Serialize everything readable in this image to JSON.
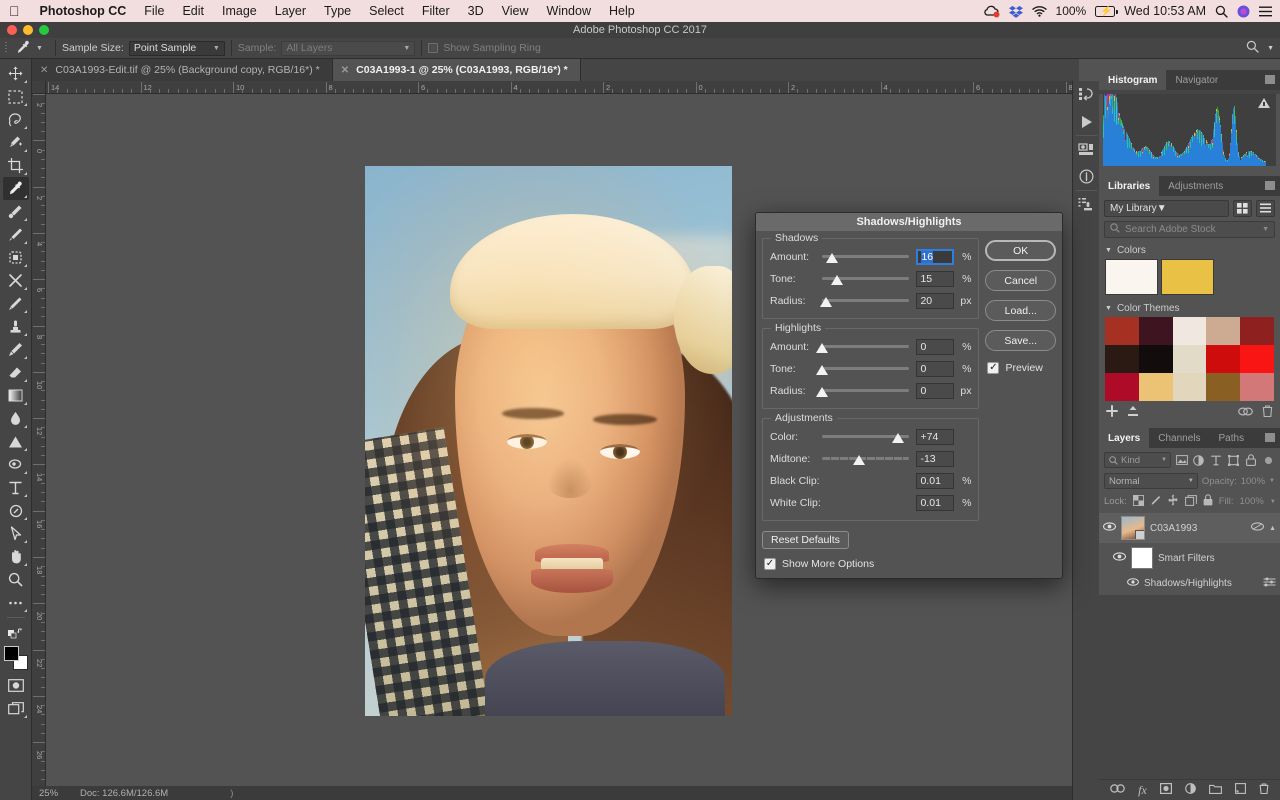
{
  "macbar": {
    "apple_icon": "apple-icon",
    "app_name": "Photoshop CC",
    "menus": [
      "File",
      "Edit",
      "Image",
      "Layer",
      "Type",
      "Select",
      "Filter",
      "3D",
      "View",
      "Window",
      "Help"
    ],
    "battery_pct": "100%",
    "clock": "Wed 10:53 AM",
    "right_icons": [
      "cloud-sync-icon",
      "dropbox-icon",
      "wifi-icon",
      "battery-icon",
      "spotlight-search-icon",
      "siri-icon",
      "notification-center-icon"
    ]
  },
  "titlebar": {
    "title": "Adobe Photoshop CC 2017",
    "traffic": [
      {
        "name": "close-button",
        "color": "#ff5f57"
      },
      {
        "name": "minimize-button",
        "color": "#febc2e"
      },
      {
        "name": "zoom-button",
        "color": "#28c840"
      }
    ]
  },
  "options_bar": {
    "tool_icon": "eyedropper-icon",
    "sample_size_label": "Sample Size:",
    "sample_size_value": "Point Sample",
    "sample_label": "Sample:",
    "sample_value": "All Layers",
    "show_sampling_ring_label": "Show Sampling Ring",
    "search_icon": "search-icon"
  },
  "tabs": [
    {
      "label": "C03A1993-Edit.tif @ 25% (Background copy, RGB/16*) *",
      "active": false
    },
    {
      "label": "C03A1993-1 @ 25% (C03A1993, RGB/16*) *",
      "active": true
    }
  ],
  "toolbar": {
    "tools": [
      {
        "name": "move-tool",
        "glyph": "move"
      },
      {
        "name": "rectangular-marquee-tool",
        "glyph": "marquee"
      },
      {
        "name": "lasso-tool",
        "glyph": "lasso"
      },
      {
        "name": "quick-selection-tool",
        "glyph": "wand"
      },
      {
        "name": "crop-tool",
        "glyph": "crop"
      },
      {
        "name": "eyedropper-tool",
        "glyph": "eyedropper",
        "active": true
      },
      {
        "name": "spot-healing-brush-tool",
        "glyph": "heal"
      },
      {
        "name": "brush-tool",
        "glyph": "brush2"
      },
      {
        "name": "clone-stamp-tool",
        "glyph": "patch"
      },
      {
        "name": "history-brush-tool",
        "glyph": "hbrush"
      },
      {
        "name": "eraser-tool",
        "glyph": "brush"
      },
      {
        "name": "stamp-tool",
        "glyph": "stamp"
      },
      {
        "name": "mixer-brush-tool",
        "glyph": "mixer"
      },
      {
        "name": "eraser-tool-2",
        "glyph": "eraser"
      },
      {
        "name": "gradient-tool",
        "glyph": "gradient"
      },
      {
        "name": "blur-tool",
        "glyph": "blur"
      },
      {
        "name": "dodge-tool",
        "glyph": "dodge"
      },
      {
        "name": "pen-tool",
        "glyph": "pen"
      },
      {
        "name": "type-tool",
        "glyph": "type"
      },
      {
        "name": "path-selection-tool",
        "glyph": "ellipse"
      },
      {
        "name": "direct-selection-tool",
        "glyph": "arrow"
      },
      {
        "name": "hand-tool",
        "glyph": "hand"
      },
      {
        "name": "zoom-tool",
        "glyph": "zoom"
      },
      {
        "name": "edit-toolbar-button",
        "glyph": "dots"
      }
    ],
    "quickmask_name": "quick-mask-button",
    "screenmode_name": "screen-mode-button",
    "foreground_color": "#000000",
    "background_color": "#ffffff"
  },
  "rulers": {
    "horizontal": [
      "14",
      "12",
      "10",
      "8",
      "6",
      "4",
      "2",
      "0",
      "2",
      "4",
      "6",
      "8"
    ],
    "vertical": [
      "2",
      "0",
      "2",
      "4",
      "6",
      "8",
      "10",
      "12",
      "14",
      "16",
      "18",
      "20",
      "22",
      "24",
      "26"
    ]
  },
  "statusbar": {
    "zoom": "25%",
    "doc": "Doc: 126.6M/126.6M",
    "arrow": ")"
  },
  "rail": {
    "icons": [
      "history-panel-icon",
      "play-action-icon",
      "properties-panel-icon",
      "info-panel-icon",
      "clone-source-panel-icon"
    ]
  },
  "panels": {
    "histogram": {
      "tabs": [
        {
          "label": "Histogram",
          "active": true
        },
        {
          "label": "Navigator",
          "active": false
        }
      ],
      "warning_icon": "histogram-warning-icon"
    },
    "libraries": {
      "tabs": [
        {
          "label": "Libraries",
          "active": true
        },
        {
          "label": "Adjustments",
          "active": false
        }
      ],
      "library_name": "My Library",
      "grid_view_icon": "grid-view-icon",
      "list_view_icon": "list-view-icon",
      "search_placeholder": "Search Adobe Stock",
      "colors_section": "Colors",
      "color_swatches": [
        "#faf6ef",
        "#e9c245"
      ],
      "themes_section": "Color Themes",
      "theme_rows": [
        [
          "#a63123",
          "#3d1420",
          "#f0e8e0",
          "#ccab92",
          "#8e2020"
        ],
        [
          "#2b1913",
          "#120d0c",
          "#e2dbc7",
          "#cf0c0c",
          "#fa1515"
        ],
        [
          "#ad0b28",
          "#ecc274",
          "#e2d6bd",
          "#8a5f23",
          "#d37878"
        ]
      ],
      "footer_icons": [
        "add-icon",
        "upload-icon",
        "cloud-icon",
        "trash-icon"
      ]
    },
    "layers": {
      "tabs": [
        {
          "label": "Layers",
          "active": true
        },
        {
          "label": "Channels",
          "active": false
        },
        {
          "label": "Paths",
          "active": false
        }
      ],
      "filter_kind": "Kind",
      "filter_icons": [
        "pixel-filter-icon",
        "adjustment-filter-icon",
        "type-filter-icon",
        "shape-filter-icon",
        "smartobject-filter-icon"
      ],
      "filter_toggle_name": "filter-toggle",
      "blend_mode": "Normal",
      "opacity_label": "Opacity:",
      "opacity_value": "100%",
      "lock_label": "Lock:",
      "lock_icons": [
        "lock-transparent-icon",
        "lock-image-icon",
        "lock-position-icon",
        "lock-artboard-icon",
        "lock-all-icon"
      ],
      "fill_label": "Fill:",
      "fill_value": "100%",
      "rows": [
        {
          "name": "C03A1993",
          "type": "smart-object",
          "eye": true
        },
        {
          "name": "Smart Filters",
          "type": "filter-group",
          "eye": true
        },
        {
          "name": "Shadows/Highlights",
          "type": "filter",
          "eye": true
        }
      ],
      "footer_icons": [
        "link-layers-icon",
        "layer-style-fx-icon",
        "add-mask-icon",
        "new-fill-adjustment-icon",
        "new-group-icon",
        "new-layer-icon",
        "delete-layer-icon"
      ]
    }
  },
  "dialog": {
    "title": "Shadows/Highlights",
    "groups": [
      {
        "label": "Shadows",
        "rows": [
          {
            "label": "Amount:",
            "value": "16",
            "unit": "%",
            "knob_pct": 12,
            "focused": true,
            "ticks": false
          },
          {
            "label": "Tone:",
            "value": "15",
            "unit": "%",
            "knob_pct": 17,
            "focused": false,
            "ticks": false
          },
          {
            "label": "Radius:",
            "value": "20",
            "unit": "px",
            "knob_pct": 5,
            "focused": false,
            "ticks": false
          }
        ]
      },
      {
        "label": "Highlights",
        "rows": [
          {
            "label": "Amount:",
            "value": "0",
            "unit": "%",
            "knob_pct": 0,
            "focused": false,
            "ticks": false
          },
          {
            "label": "Tone:",
            "value": "0",
            "unit": "%",
            "knob_pct": 0,
            "focused": false,
            "ticks": false
          },
          {
            "label": "Radius:",
            "value": "0",
            "unit": "px",
            "knob_pct": 0,
            "focused": false,
            "ticks": false
          }
        ]
      },
      {
        "label": "Adjustments",
        "rows": [
          {
            "label": "Color:",
            "value": "+74",
            "unit": "",
            "knob_pct": 87,
            "focused": false,
            "ticks": false
          },
          {
            "label": "Midtone:",
            "value": "-13",
            "unit": "",
            "knob_pct": 42,
            "focused": false,
            "ticks": true
          }
        ],
        "plain_rows": [
          {
            "label": "Black Clip:",
            "value": "0.01",
            "unit": "%"
          },
          {
            "label": "White Clip:",
            "value": "0.01",
            "unit": "%"
          }
        ]
      }
    ],
    "buttons": [
      {
        "label": "OK",
        "default": true
      },
      {
        "label": "Cancel",
        "default": false
      },
      {
        "label": "Load...",
        "default": false
      },
      {
        "label": "Save...",
        "default": false
      }
    ],
    "preview_label": "Preview",
    "preview_checked": true,
    "reset_label": "Reset Defaults",
    "show_more_label": "Show More Options",
    "show_more_checked": true
  }
}
